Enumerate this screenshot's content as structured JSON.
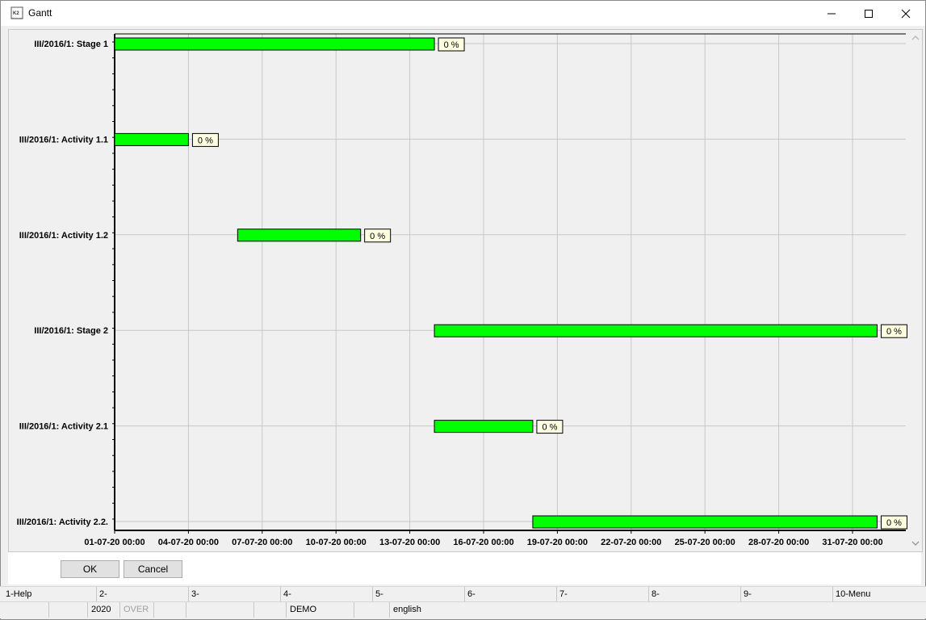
{
  "window": {
    "title": "Gantt",
    "icon": "k2-app-icon",
    "controls": [
      "minimize-icon",
      "maximize-icon",
      "close-icon"
    ]
  },
  "chart_data": {
    "type": "gantt",
    "tasks": [
      {
        "name": "III/2016/1: Stage 1",
        "start": "01-07-20 00:00",
        "end": "14-07-20 00:00",
        "progress_label": "0 %",
        "progress": 0
      },
      {
        "name": "III/2016/1: Activity 1.1",
        "start": "01-07-20 00:00",
        "end": "04-07-20 00:00",
        "progress_label": "0 %",
        "progress": 0
      },
      {
        "name": "III/2016/1: Activity 1.2",
        "start": "06-07-20 00:00",
        "end": "11-07-20 00:00",
        "progress_label": "0 %",
        "progress": 0
      },
      {
        "name": "III/2016/1: Stage 2",
        "start": "14-07-20 00:00",
        "end": "01-08-20 00:00",
        "progress_label": "0 %",
        "progress": 0
      },
      {
        "name": "III/2016/1: Activity 2.1",
        "start": "14-07-20 00:00",
        "end": "18-07-20 00:00",
        "progress_label": "0 %",
        "progress": 0
      },
      {
        "name": "III/2016/1: Activity 2.2.",
        "start": "18-07-20 00:00",
        "end": "01-08-20 00:00",
        "progress_label": "0 %",
        "progress": 0
      }
    ],
    "x_ticks": [
      "01-07-20 00:00",
      "04-07-20 00:00",
      "07-07-20 00:00",
      "10-07-20 00:00",
      "13-07-20 00:00",
      "16-07-20 00:00",
      "19-07-20 00:00",
      "22-07-20 00:00",
      "25-07-20 00:00",
      "28-07-20 00:00",
      "31-07-20 00:00"
    ],
    "xlim": [
      "01-07-20 00:00",
      "02-08-20 04:00"
    ],
    "grid": true,
    "bar_color": "#00ff00",
    "label_bg": "#ffffe1"
  },
  "buttons": {
    "ok": "OK",
    "cancel": "Cancel"
  },
  "function_keys": [
    "1-Help",
    "2-",
    "3-",
    "4-",
    "5-",
    "6-",
    "7-",
    "8-",
    "9-",
    "10-Menu"
  ],
  "status": {
    "year": "2020",
    "mode": "OVER",
    "db": "DEMO",
    "language": "english"
  }
}
